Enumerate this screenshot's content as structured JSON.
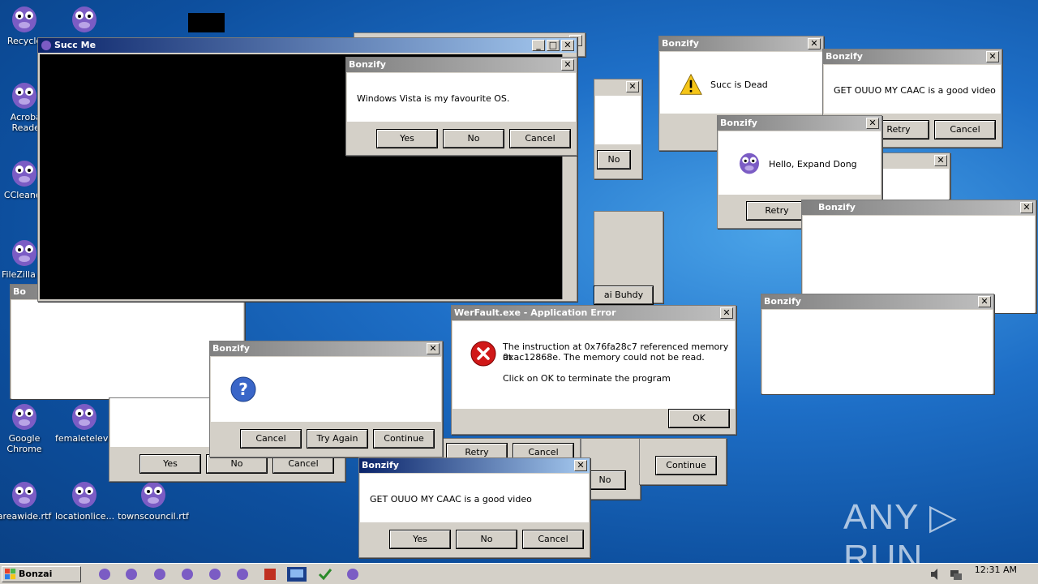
{
  "desktop": {
    "icons": [
      {
        "label": "Recycle"
      },
      {
        "label": "Acrobat Reader"
      },
      {
        "label": "CCleaner"
      },
      {
        "label": "FileZilla Cl"
      },
      {
        "label": "Google Chrome"
      },
      {
        "label": "femaletelevi..."
      },
      {
        "label": "areawide.rtf"
      },
      {
        "label": "locationlice..."
      },
      {
        "label": "townscouncil.rtf"
      }
    ]
  },
  "windows": {
    "succ_me": {
      "title": "Succ Me"
    },
    "vista": {
      "title": "Bonzify",
      "message": "Windows Vista is my favourite OS.",
      "buttons": [
        "Yes",
        "No",
        "Cancel"
      ]
    },
    "succ_dead": {
      "title": "Bonzify",
      "message": "Succ is Dead",
      "icon": "warning-icon"
    },
    "get_ouuo_top": {
      "title": "Bonzify",
      "message": "GET OUUO MY CAAC is a good video",
      "buttons": [
        "Retry",
        "Cancel"
      ]
    },
    "hello": {
      "title": "Bonzify",
      "message": "Hello, Expand Dong",
      "buttons": [
        "Retry"
      ]
    },
    "blank_right": {
      "title": "Bonzify"
    },
    "blank_right2": {
      "title": "Bonzify"
    },
    "question": {
      "title": "Bonzify",
      "icon": "question-icon",
      "buttons": [
        "Cancel",
        "Try Again",
        "Continue"
      ]
    },
    "werfault": {
      "title": "WerFault.exe - Application Error",
      "line1": "The instruction at 0x76fa28c7 referenced memory at",
      "line2": "0xac12868e. The memory could not be read.",
      "line3": "Click on OK to terminate the program",
      "ok": "OK",
      "icon": "error-icon"
    },
    "get_ouuo_bottom": {
      "title": "Bonzify",
      "message": "GET OUUO MY CAAC is a good video",
      "buttons": [
        "Yes",
        "No",
        "Cancel"
      ]
    },
    "behind_left": {
      "title": "Bo",
      "buttons": [
        "Yes",
        "No",
        "Cancel"
      ]
    },
    "behind_mid": {
      "buttons": [
        "Retry",
        "Cancel",
        "No",
        "Continue"
      ]
    },
    "behind_no": {
      "button": "No"
    },
    "behind_buhdy": {
      "label": "ai Buhdy"
    }
  },
  "taskbar": {
    "start_label": "Bonzai Buhdy",
    "clock": "12:31 AM"
  },
  "watermark": {
    "text": "ANY ▷ RUN"
  },
  "colors": {
    "desktop_blue": "#1e6fc7",
    "titlebar_inactive": "#808080",
    "titlebar_active": "#0a246a",
    "bonzi_purple": "#7b5cc4"
  }
}
